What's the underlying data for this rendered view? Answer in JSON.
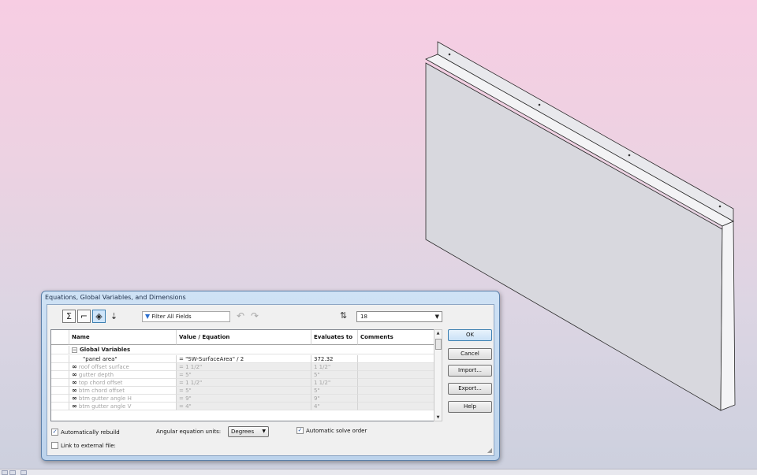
{
  "dialog": {
    "title": "Equations, Global Variables, and Dimensions",
    "filter_placeholder": "Filter All Fields",
    "precision": "18",
    "icons": {
      "equation_view": "sigma-icon",
      "sketch_equation_view": "sketch-icon",
      "dimension_view": "dimension-icon",
      "ordered_view": "ordered-view-icon",
      "filter": "filter-icon",
      "undo": "undo-icon",
      "redo": "redo-icon",
      "sort": "sort-icon"
    },
    "columns": [
      "Name",
      "Value / Equation",
      "Evaluates to",
      "Comments"
    ],
    "group_label": "Global Variables",
    "rows": [
      {
        "name": "\"panel area\"",
        "value": "= \"SW-SurfaceArea\" / 2",
        "evaluates": "372.32",
        "linked": false
      },
      {
        "name": "roof offset surface",
        "value": "= 1 1/2\"",
        "evaluates": "1 1/2\"",
        "linked": true
      },
      {
        "name": "gutter depth",
        "value": "= 5\"",
        "evaluates": "5\"",
        "linked": true
      },
      {
        "name": "top chord offset",
        "value": "= 1 1/2\"",
        "evaluates": "1 1/2\"",
        "linked": true
      },
      {
        "name": "btm chord offset",
        "value": "= 5\"",
        "evaluates": "5\"",
        "linked": true
      },
      {
        "name": "btm gutter angle H",
        "value": "= 9\"",
        "evaluates": "9\"",
        "linked": true
      },
      {
        "name": "btm gutter angle V",
        "value": "= 4\"",
        "evaluates": "4\"",
        "linked": true
      }
    ],
    "buttons": {
      "ok": "OK",
      "cancel": "Cancel",
      "import": "Import...",
      "export": "Export...",
      "help": "Help"
    },
    "options": {
      "auto_rebuild": "Automatically rebuild",
      "auto_rebuild_checked": true,
      "angular_units_label": "Angular equation units:",
      "angular_units_value": "Degrees",
      "auto_solve": "Automatic solve order",
      "auto_solve_checked": true,
      "link_external": "Link to external file:",
      "link_external_checked": false
    }
  },
  "colors": {
    "accent": "#3c7fb1",
    "dialog_frame": "#bcd3ec",
    "panel_face": "#d6d6dc"
  }
}
